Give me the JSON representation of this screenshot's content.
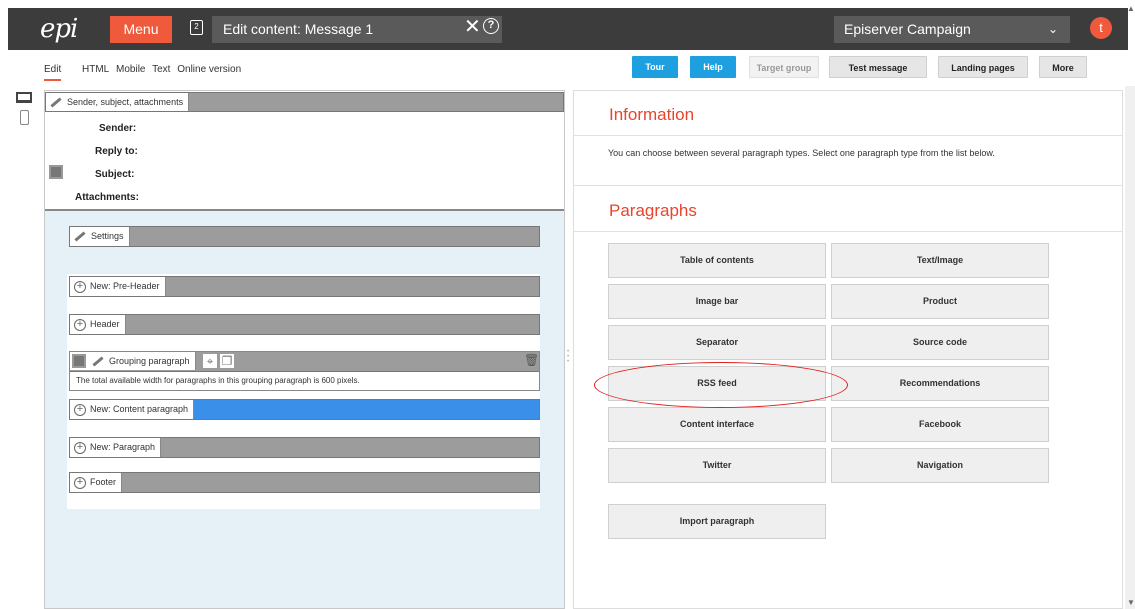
{
  "header": {
    "logo": "epi",
    "menu_label": "Menu",
    "tabs_count": "2",
    "title": "Edit content: Message 1",
    "site": "Episerver Campaign",
    "user_initial": "t"
  },
  "toolbar": {
    "view_tabs": [
      "Edit",
      "HTML",
      "Mobile",
      "Text",
      "Online version"
    ],
    "buttons": {
      "tour": "Tour",
      "help": "Help",
      "target_group": "Target group",
      "test_message": "Test message",
      "landing_pages": "Landing pages",
      "more": "More"
    }
  },
  "editor": {
    "meta_bar_label": "Sender, subject, attachments",
    "fields": {
      "sender": "Sender:",
      "reply_to": "Reply to:",
      "subject": "Subject:",
      "attachments": "Attachments:"
    },
    "blocks": {
      "settings": "Settings",
      "pre_header": "New: Pre-Header",
      "header": "Header",
      "grouping": "Grouping paragraph",
      "grouping_note": "The total available width for paragraphs in this grouping paragraph is 600 pixels.",
      "content_paragraph": "New: Content paragraph",
      "paragraph": "New: Paragraph",
      "footer": "Footer"
    }
  },
  "panel": {
    "info_heading": "Information",
    "info_text": "You can choose between several paragraph types. Select one paragraph type from the list below.",
    "paragraphs_heading": "Paragraphs",
    "paragraph_types": [
      "Table of contents",
      "Text/Image",
      "Image bar",
      "Product",
      "Separator",
      "Source code",
      "RSS feed",
      "Recommendations",
      "Content interface",
      "Facebook",
      "Twitter",
      "Navigation"
    ],
    "import_label": "Import paragraph"
  },
  "colors": {
    "accent": "#ef5a3c",
    "primary_button": "#1e9fe0",
    "topbar": "#3c3c3c",
    "highlight": "#3a8fe8"
  }
}
